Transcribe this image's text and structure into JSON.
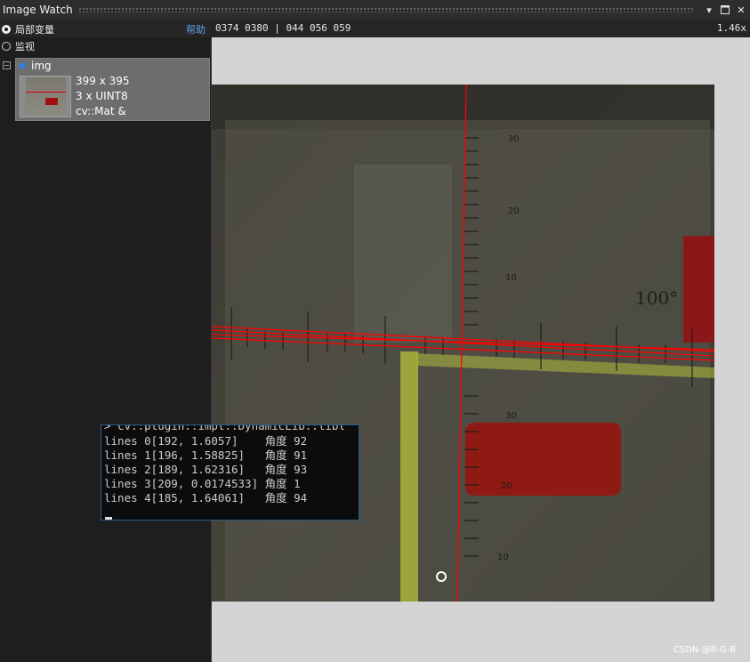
{
  "window": {
    "title": "Image Watch"
  },
  "toolbar": {
    "radio_local_label": "局部变量",
    "radio_watch_label": "监视",
    "help_label": "帮助",
    "pixel_info": "0374 0380 | 044 056 059",
    "zoom": "1.46x"
  },
  "variable": {
    "name": "img",
    "size": "399 x 395",
    "channels": "3 x UINT8",
    "type": "cv::Mat &"
  },
  "console": {
    "lines": [
      "> cv::plugin::impl::DynamicLib::libl",
      "lines 0[192, 1.6057]    角度 92",
      "lines 1[196, 1.58825]   角度 91",
      "lines 2[189, 1.62316]   角度 93",
      "lines 3[209, 0.0174533] 角度 1",
      "lines 4[185, 1.64061]   角度 94"
    ]
  },
  "image_labels": {
    "deg": "100°",
    "ticks": [
      "30",
      "20",
      "10",
      "30",
      "20",
      "10"
    ]
  },
  "watermark": "CSDN @R-G-B",
  "colors": {
    "accent_blue": "#2f7de1",
    "detected_line": "#ff0000",
    "title_bar": "#2d2d30"
  }
}
